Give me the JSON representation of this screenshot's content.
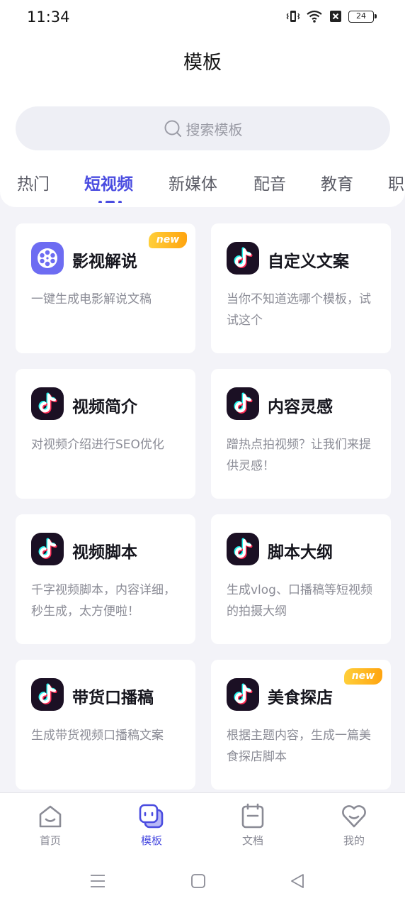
{
  "status_bar": {
    "time": "11:34",
    "battery": "24"
  },
  "header": {
    "title": "模板"
  },
  "search": {
    "placeholder": "搜索模板"
  },
  "tabs": [
    {
      "label": "热门"
    },
    {
      "label": "短视频",
      "active": true
    },
    {
      "label": "新媒体"
    },
    {
      "label": "配音"
    },
    {
      "label": "教育"
    },
    {
      "label": "职"
    }
  ],
  "cards": [
    {
      "title": "影视解说",
      "desc": "一键生成电影解说文稿",
      "badge": "new",
      "icon": "film-reel-icon"
    },
    {
      "title": "自定义文案",
      "desc": "当你不知道选哪个模板，试试这个",
      "icon": "tiktok-icon"
    },
    {
      "title": "视频简介",
      "desc": "对视频介绍进行SEO优化",
      "icon": "tiktok-icon"
    },
    {
      "title": "内容灵感",
      "desc": "蹭热点拍视频？让我们来提供灵感！",
      "icon": "tiktok-icon"
    },
    {
      "title": "视频脚本",
      "desc": "千字视频脚本，内容详细，秒生成，太方便啦！",
      "icon": "tiktok-icon"
    },
    {
      "title": "脚本大纲",
      "desc": "生成vlog、口播稿等短视频的拍摄大纲",
      "icon": "tiktok-icon"
    },
    {
      "title": "带货口播稿",
      "desc": "生成带货视频口播稿文案",
      "icon": "tiktok-icon"
    },
    {
      "title": "美食探店",
      "desc": "根据主题内容，生成一篇美食探店脚本",
      "badge": "new",
      "icon": "tiktok-icon"
    }
  ],
  "bottom_nav": [
    {
      "label": "首页",
      "icon": "home-icon"
    },
    {
      "label": "模板",
      "icon": "template-icon",
      "active": true
    },
    {
      "label": "文档",
      "icon": "document-icon"
    },
    {
      "label": "我的",
      "icon": "heart-smile-icon"
    }
  ],
  "colors": {
    "accent": "#4a4ce0",
    "badge": "#ffb21d",
    "background": "#f3f3f8"
  }
}
